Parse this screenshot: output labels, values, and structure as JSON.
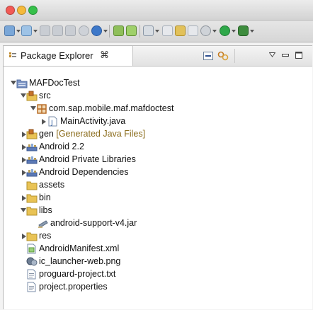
{
  "view": {
    "tab_label": "Package Explorer"
  },
  "tree": {
    "project": "MAFDocTest",
    "src": "src",
    "package": "com.sap.mobile.maf.mafdoctest",
    "main_activity": "MainActivity.java",
    "gen": "gen",
    "gen_decoration": "[Generated Java Files]",
    "android_lib": "Android 2.2",
    "private_libs": "Android Private Libraries",
    "dependencies": "Android Dependencies",
    "assets": "assets",
    "bin": "bin",
    "libs": "libs",
    "support_jar": "android-support-v4.jar",
    "res": "res",
    "manifest": "AndroidManifest.xml",
    "launcher_png": "ic_launcher-web.png",
    "proguard": "proguard-project.txt",
    "properties": "project.properties"
  },
  "colors": {
    "close_light": "#f25a55",
    "minimize_light": "#f5b93a",
    "zoom_light": "#36c04a",
    "folder": "#e9c355",
    "library": "#5b79b6",
    "package": "#b5651d"
  }
}
